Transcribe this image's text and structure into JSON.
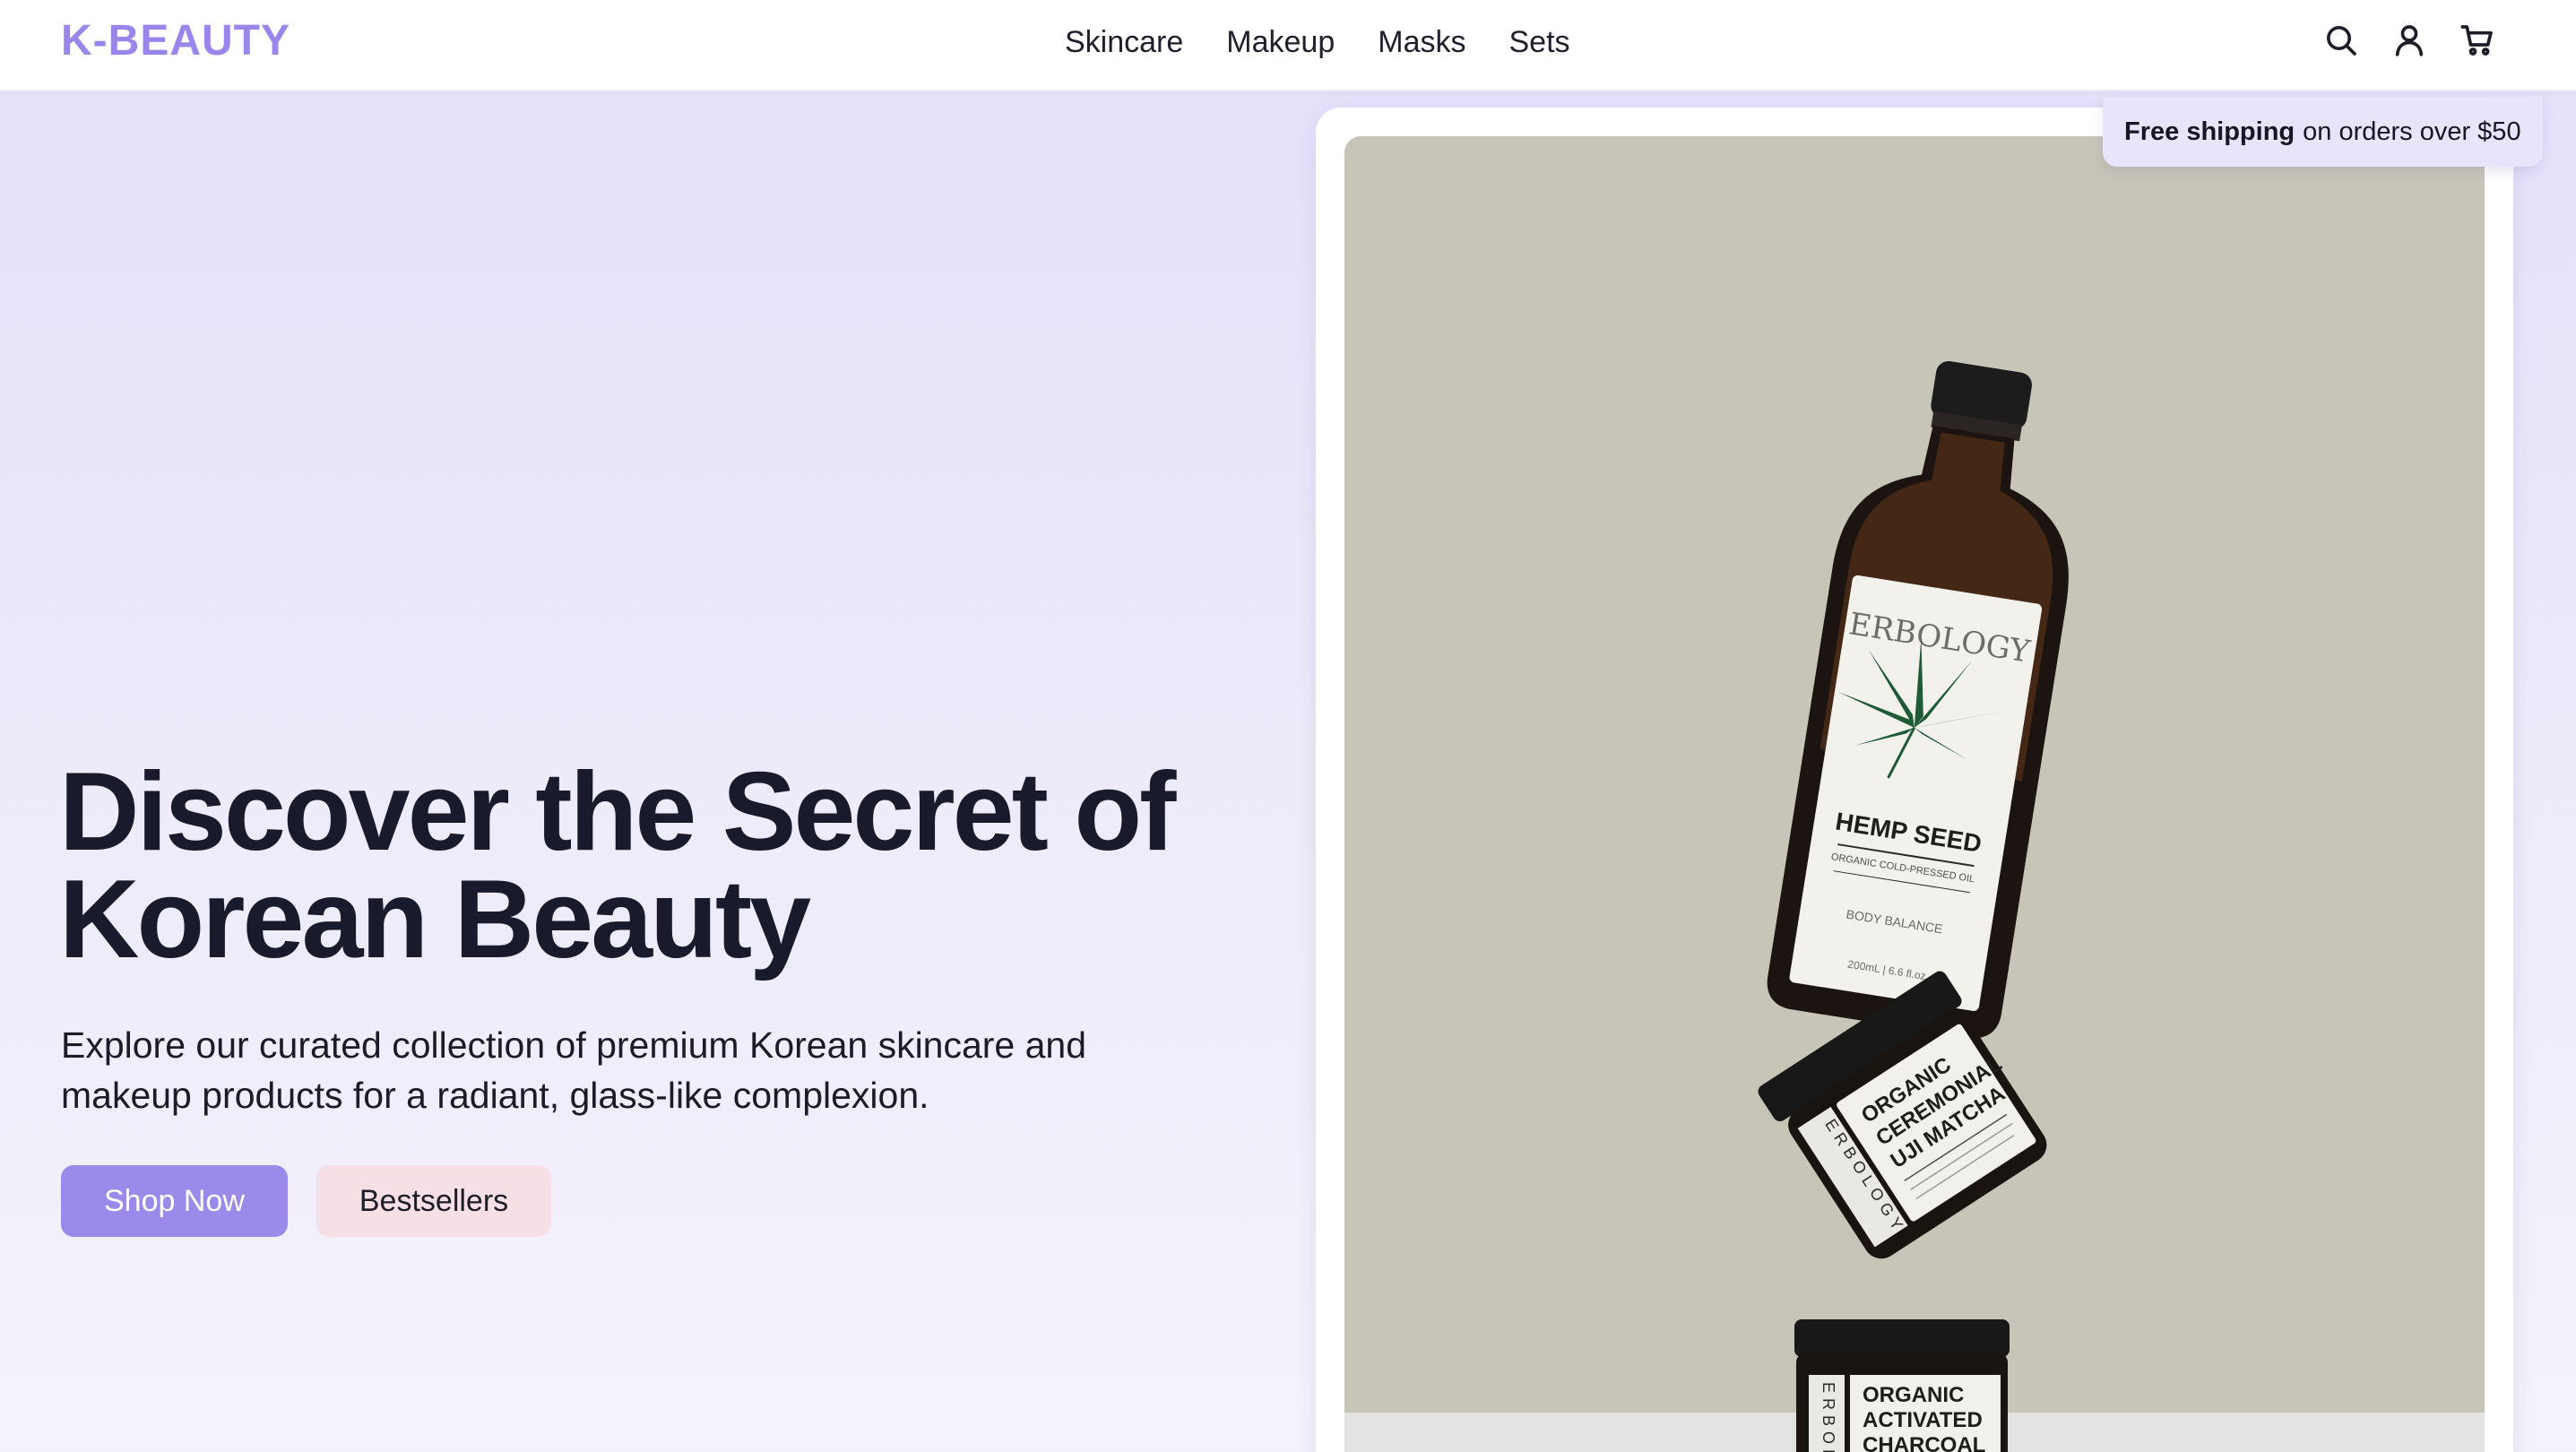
{
  "brand": {
    "logo": "K-BEAUTY",
    "accent": "#9a86ea"
  },
  "nav": {
    "items": [
      {
        "label": "Skincare"
      },
      {
        "label": "Makeup"
      },
      {
        "label": "Masks"
      },
      {
        "label": "Sets"
      }
    ]
  },
  "header_icons": [
    "search-icon",
    "user-icon",
    "cart-icon"
  ],
  "hero": {
    "title_line1": "Discover the Secret of",
    "title_line2": "Korean Beauty",
    "subtitle_line1": "Explore our curated collection of premium Korean skincare and",
    "subtitle_line2": "makeup products for a radiant, glass-like complexion.",
    "primary_button": "Shop Now",
    "secondary_button": "Bestsellers",
    "primary_color": "#9c8aea",
    "secondary_color": "#f7dfe6"
  },
  "shipping_badge": {
    "bold": "Free shipping",
    "rest": "on orders over $50"
  },
  "product_photo": {
    "bottle_brand": "ERBOLOGY",
    "bottle_name": "HEMP SEED",
    "bottle_sub": "ORGANIC COLD-PRESSED OIL",
    "bottle_line": "BODY BALANCE",
    "bottle_volume": "200mL | 6.6 fl.oz",
    "jar1_line1": "ORGANIC",
    "jar1_line2": "CEREMONIAL",
    "jar1_line3": "UJI MATCHA",
    "jar1_side": "ERBOLOGY",
    "jar2_line1": "ORGANIC",
    "jar2_line2": "ACTIVATED",
    "jar2_line3": "CHARCOAL",
    "jar2_side": "ERBOLOGY"
  }
}
